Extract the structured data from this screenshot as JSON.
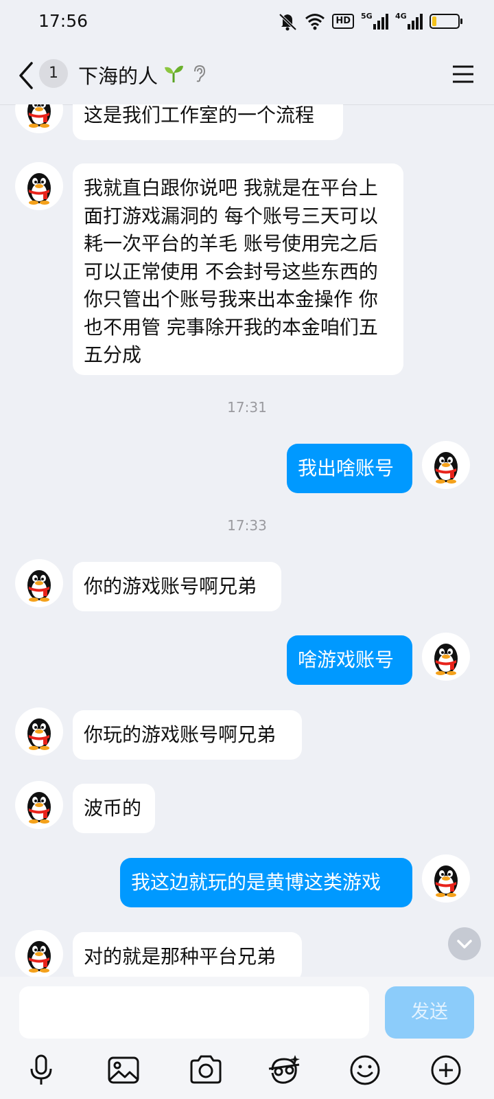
{
  "status_bar": {
    "time": "17:56",
    "hd_label": "HD",
    "net1_label": "5G",
    "net2_label": "4G",
    "battery_level": 0.18,
    "icons": [
      "mute-icon",
      "wifi-icon",
      "hd-volte-icon",
      "signal-5g-icon",
      "signal-4g-icon",
      "battery-icon"
    ]
  },
  "header": {
    "unread_count": "1",
    "title": "下海的人",
    "icons": [
      "back-icon",
      "sprout-icon",
      "ear-icon",
      "menu-icon"
    ]
  },
  "messages": [
    {
      "side": "in",
      "text": "这是我们工作室的一个流程"
    },
    {
      "side": "in",
      "text": "我就直白跟你说吧 我就是在平台上面打游戏漏洞的 每个账号三天可以耗一次平台的羊毛 账号使用完之后可以正常使用 不会封号这些东西的 你只管出个账号我来出本金操作 你也不用管 完事除开我的本金咱们五五分成"
    },
    {
      "type": "time",
      "text": "17:31"
    },
    {
      "side": "out",
      "text": "我出啥账号"
    },
    {
      "type": "time",
      "text": "17:33"
    },
    {
      "side": "in",
      "text": "你的游戏账号啊兄弟"
    },
    {
      "side": "out",
      "text": "啥游戏账号"
    },
    {
      "side": "in",
      "text": "你玩的游戏账号啊兄弟"
    },
    {
      "side": "in",
      "text": "波币的"
    },
    {
      "side": "out",
      "text": "我这边就玩的是黄博这类游戏"
    },
    {
      "side": "in",
      "text": "对的就是那种平台兄弟"
    }
  ],
  "input": {
    "value": "",
    "placeholder": "",
    "send_label": "发送"
  },
  "toolbar_icons": [
    "microphone-icon",
    "image-icon",
    "camera-icon",
    "sticker-icon",
    "emoji-icon",
    "plus-icon"
  ],
  "colors": {
    "background": "#eef0f5",
    "outgoing_bubble": "#0099ff",
    "incoming_bubble": "#ffffff",
    "send_button": "#8cccfa"
  }
}
